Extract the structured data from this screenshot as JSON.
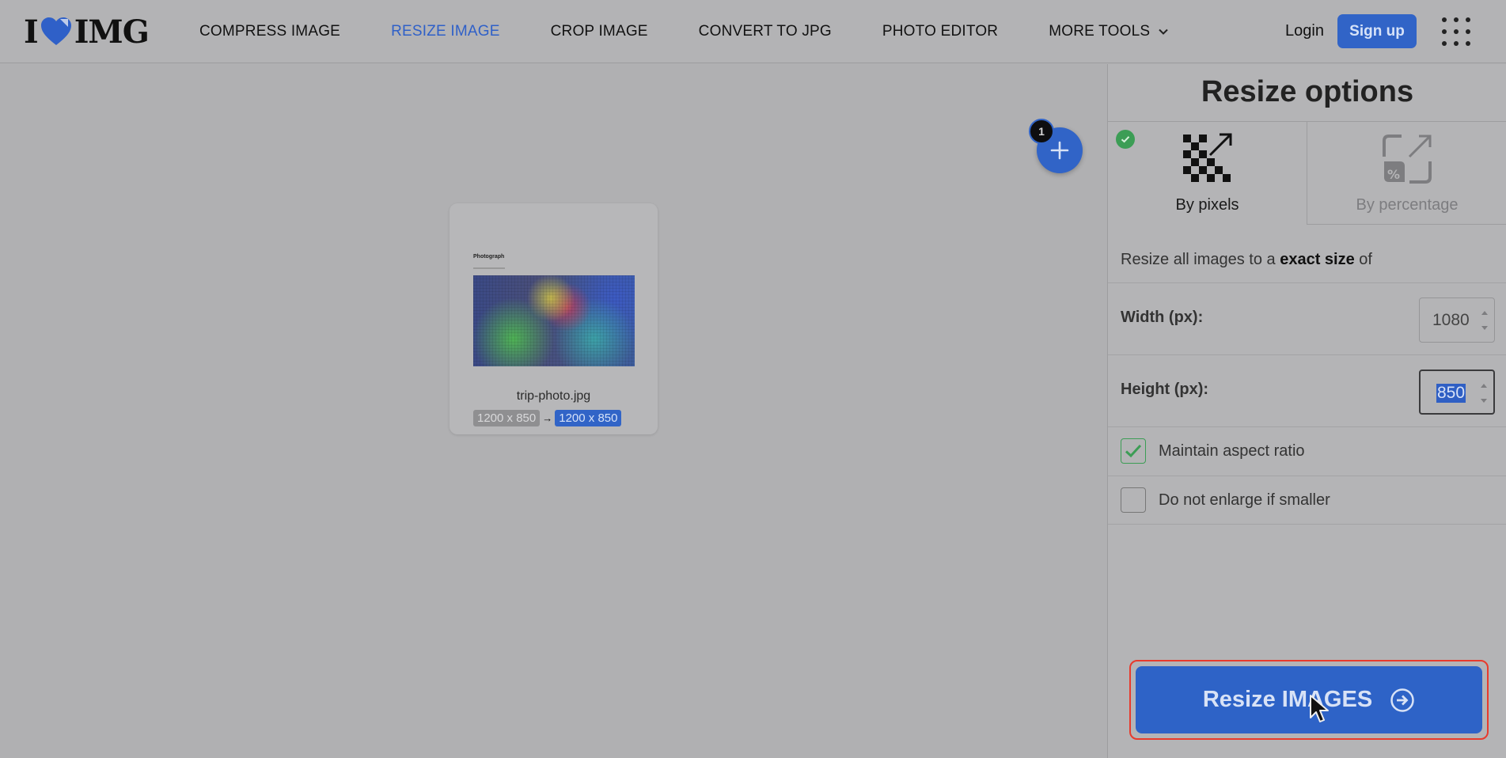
{
  "header": {
    "logo_left": "I",
    "logo_right": "IMG",
    "nav": [
      {
        "label": "COMPRESS IMAGE",
        "active": false
      },
      {
        "label": "RESIZE IMAGE",
        "active": true
      },
      {
        "label": "CROP IMAGE",
        "active": false
      },
      {
        "label": "CONVERT TO JPG",
        "active": false
      },
      {
        "label": "PHOTO EDITOR",
        "active": false
      },
      {
        "label": "MORE TOOLS",
        "active": false
      }
    ],
    "login_label": "Login",
    "signup_label": "Sign up"
  },
  "workarea": {
    "file": {
      "name": "trip-photo.jpg",
      "original_size": "1200 x 850",
      "arrow": "→",
      "new_size": "1200 x 850",
      "thumb_title": "Photograph"
    },
    "file_count": "1"
  },
  "sidebar": {
    "title": "Resize options",
    "modes": {
      "pixels_label": "By pixels",
      "percent_label": "By percentage",
      "selected": "pixels"
    },
    "description_prefix": "Resize all images to a ",
    "description_bold": "exact size",
    "description_suffix": " of",
    "width_label": "Width (px):",
    "width_value": "1080",
    "height_label": "Height (px):",
    "height_value": "850",
    "maintain_aspect_label": "Maintain aspect ratio",
    "maintain_aspect_checked": true,
    "no_enlarge_label": "Do not enlarge if smaller",
    "no_enlarge_checked": false,
    "resize_button_label": "Resize IMAGES"
  },
  "colors": {
    "accent": "#3164c7",
    "check_green": "#3c9d55",
    "highlight_red": "#e83a2c"
  }
}
